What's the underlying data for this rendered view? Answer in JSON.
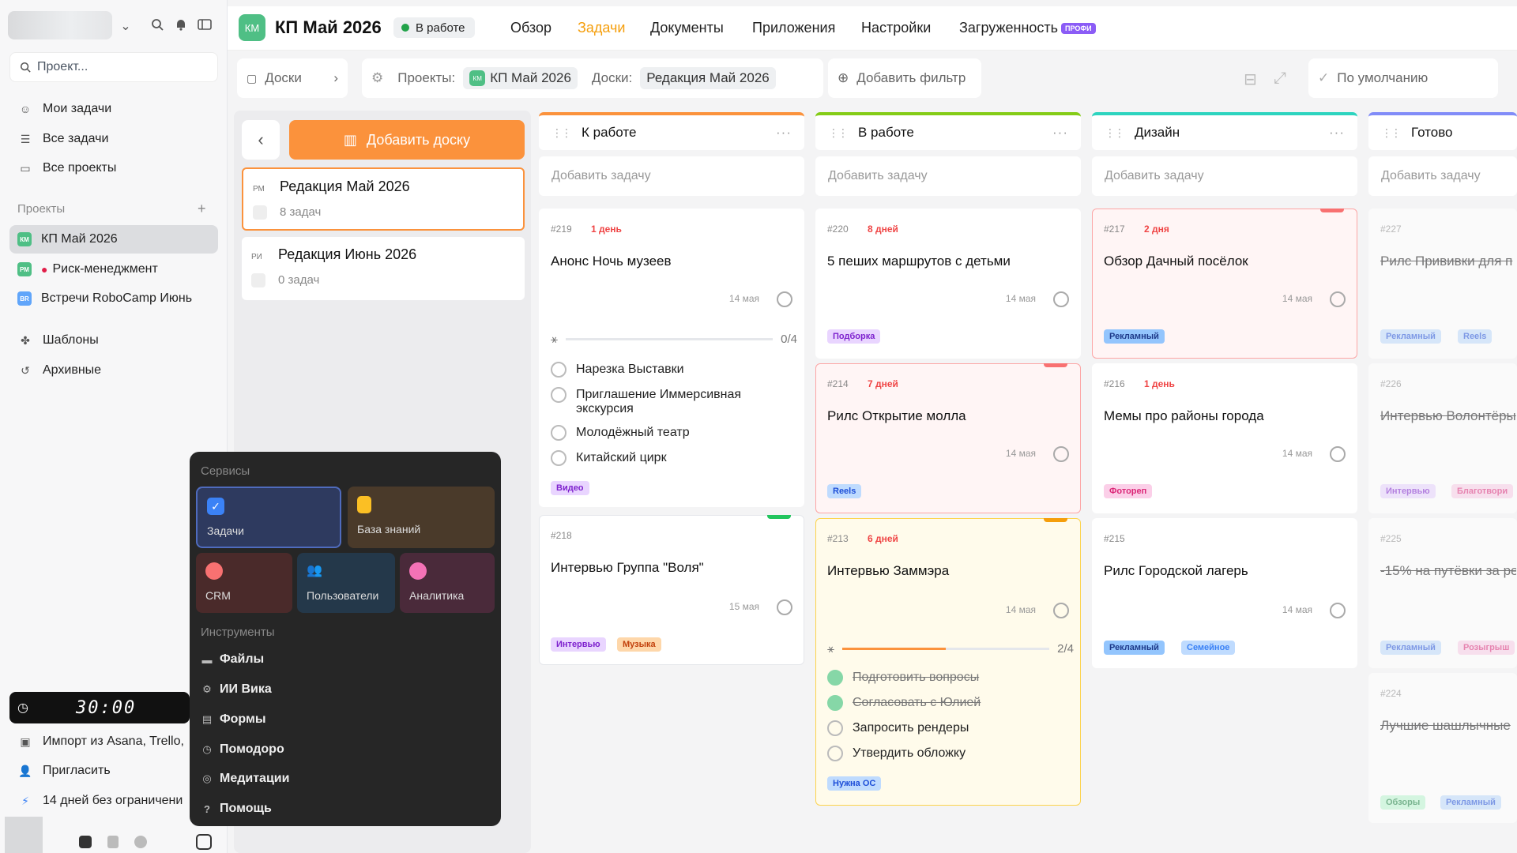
{
  "sidebar": {
    "search_placeholder": "Проект...",
    "nav": [
      "Мои задачи",
      "Все задачи",
      "Все проекты"
    ],
    "projects_label": "Проекты",
    "projects": [
      {
        "abbr": "КМ",
        "name": "КП Май 2026",
        "color": "#4fbf85"
      },
      {
        "abbr": "РМ",
        "name": "Риск-менеджмент",
        "color": "#4fbf85"
      },
      {
        "abbr": "ВR",
        "name": "Встречи RoboCamp Июнь",
        "color": "#60a5fa"
      }
    ],
    "extra": [
      "Шаблоны",
      "Архивные"
    ],
    "timer": "30:00",
    "bottom": [
      "Импорт из Asana, Trello,",
      "Пригласить",
      "14 дней без ограничени"
    ]
  },
  "topbar": {
    "badge": "КМ",
    "title": "КП Май 2026",
    "status": "В работе",
    "tabs": [
      "Обзор",
      "Задачи",
      "Документы",
      "Приложения",
      "Настройки",
      "Загруженность"
    ],
    "pro_badge": "ПРОФИ"
  },
  "filters": {
    "boards_label": "Доски",
    "projects_label": "Проекты:",
    "project_chip": "КП Май 2026",
    "project_chip_abbr": "КМ",
    "boards_filter_label": "Доски:",
    "boards_chip": "Редакция Май 2026",
    "add_filter": "Добавить фильтр",
    "default_view": "По умолчанию"
  },
  "boards_panel": {
    "add_board": "Добавить доску",
    "boards": [
      {
        "abbr": "РМ",
        "name": "Редакция Май 2026",
        "count": "8 задач"
      },
      {
        "abbr": "РИ",
        "name": "Редакция Июнь 2026",
        "count": "0 задач"
      }
    ]
  },
  "add_task": "Добавить задачу",
  "columns": [
    {
      "title": "К работе",
      "color": "#fb923c"
    },
    {
      "title": "В работе",
      "color": "#84cc16"
    },
    {
      "title": "Дизайн",
      "color": "#2dd4bf"
    },
    {
      "title": "Готово",
      "color": "#818cf8"
    }
  ],
  "cards": {
    "c219": {
      "num": "#219",
      "due": "1 день",
      "title": "Анонс Ночь музеев",
      "date": "14 мая",
      "progress": "0/4",
      "progress_fraction": 0,
      "subtasks": [
        "Нарезка Выставки",
        "Приглашение Иммерсивная экскурсия",
        "Молодёжный театр",
        "Китайский цирк"
      ],
      "tags": [
        "Видео"
      ]
    },
    "c218": {
      "num": "#218",
      "title": "Интервью Группа \"Воля\"",
      "date": "15 мая",
      "tags": [
        "Интервью",
        "Музыка"
      ]
    },
    "c220": {
      "num": "#220",
      "due": "8 дней",
      "title": "5 пеших маршрутов с детьми",
      "date": "14 мая",
      "tags": [
        "Подборка"
      ]
    },
    "c214": {
      "num": "#214",
      "due": "7 дней",
      "title": "Рилс Открытие молла",
      "date": "14 мая",
      "tags": [
        "Reels"
      ]
    },
    "c213": {
      "num": "#213",
      "due": "6 дней",
      "title": "Интервью Заммэра",
      "date": "14 мая",
      "progress": "2/4",
      "progress_fraction": 0.5,
      "subtasks": [
        "Подготовить вопросы",
        "Согласовать с Юлией",
        "Запросить рендеры",
        "Утвердить обложку"
      ],
      "tags": [
        "Нужна ОС"
      ]
    },
    "c217": {
      "num": "#217",
      "due": "2 дня",
      "title": "Обзор Дачный посёлок",
      "date": "14 мая",
      "tags": [
        "Рекламный"
      ]
    },
    "c216": {
      "num": "#216",
      "due": "1 день",
      "title": "Мемы про районы города",
      "date": "14 мая",
      "tags": [
        "Фотореп"
      ]
    },
    "c215": {
      "num": "#215",
      "title": "Рилс Городской лагерь",
      "date": "14 мая",
      "tags": [
        "Рекламный",
        "Семейное"
      ]
    },
    "c227": {
      "num": "#227",
      "title": "Рилс Прививки для п",
      "tags": [
        "Рекламный",
        "Reels"
      ]
    },
    "c226": {
      "num": "#226",
      "title": "Интервью Волонтёры",
      "tags": [
        "Интервью",
        "Благотвори"
      ]
    },
    "c225": {
      "num": "#225",
      "title": "-15% на путёвки за ре",
      "tags": [
        "Рекламный",
        "Розыгрыш"
      ]
    },
    "c224": {
      "num": "#224",
      "title": "Лучшие шашлычные",
      "tags": [
        "Обзоры",
        "Рекламный"
      ]
    }
  },
  "services": {
    "label": "Сервисы",
    "tiles": [
      "Задачи",
      "База знаний",
      "CRM",
      "Пользователи",
      "Аналитика"
    ],
    "tools_label": "Инструменты",
    "tools": [
      "Файлы",
      "ИИ Вика",
      "Формы",
      "Помодоро",
      "Медитации",
      "Помощь"
    ]
  }
}
